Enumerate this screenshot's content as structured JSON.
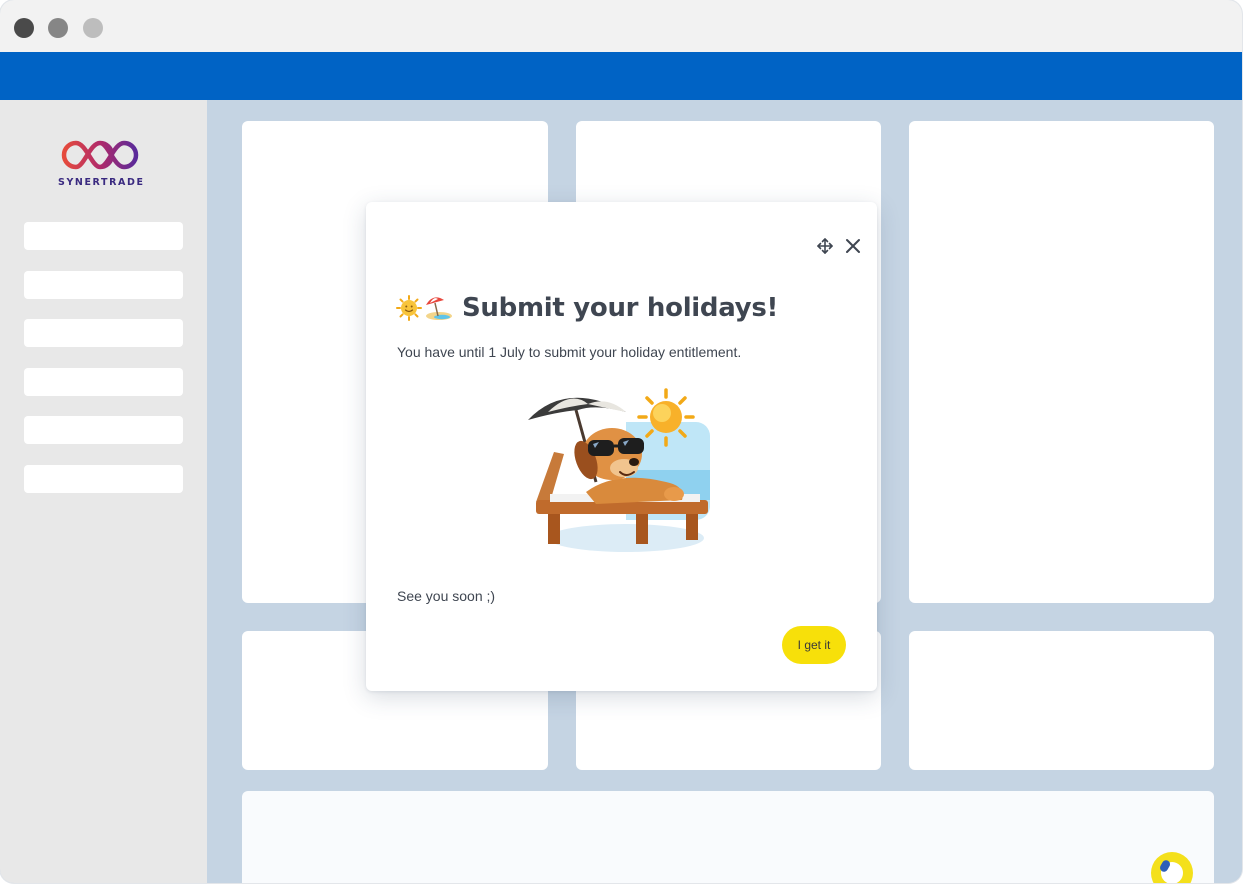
{
  "window": {
    "controls": [
      "close",
      "minimize",
      "maximize"
    ]
  },
  "colors": {
    "topnav": "#0063c5",
    "background": "#c5d4e3",
    "sidebar": "#e8e8e8",
    "accent_yellow": "#f7e00a",
    "text": "#3f4651"
  },
  "sidebar": {
    "logo": {
      "text": "SYNERTRADE",
      "icon": "synertrade-logo-icon"
    },
    "items": [
      "",
      "",
      "",
      "",
      "",
      ""
    ]
  },
  "modal": {
    "title_emojis": [
      "sun-emoji",
      "beach-umbrella-emoji"
    ],
    "title": "Submit your holidays!",
    "body": "You have until 1 July to submit your holiday entitlement.",
    "illustration": "dog-sunbathing-illustration",
    "footer_text": "See you soon ;)",
    "button_label": "I get it",
    "icons": [
      "move-icon",
      "close-icon"
    ]
  },
  "launcher": {
    "icon": "assistant-launcher-icon"
  }
}
